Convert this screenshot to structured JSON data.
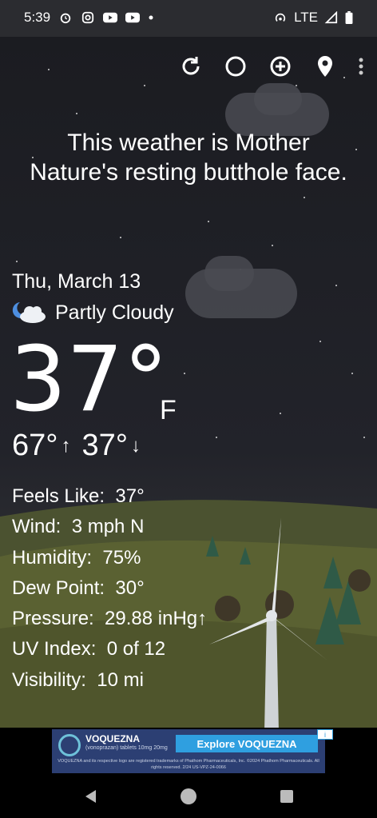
{
  "status_bar": {
    "time": "5:39",
    "left_icons": [
      "alarm-icon",
      "instagram-icon",
      "youtube-icon",
      "youtube-icon",
      "dot-icon"
    ],
    "network": "LTE",
    "right_icons": [
      "hotspot-icon",
      "signal-icon",
      "battery-icon"
    ]
  },
  "toolbar": {
    "icons": [
      "refresh-icon",
      "theme-icon",
      "add-location-icon",
      "location-pin-icon",
      "more-vert-icon"
    ]
  },
  "headline": "This weather is Mother Nature's resting butthole face.",
  "weather": {
    "date": "Thu, March 13",
    "condition": "Partly Cloudy",
    "condition_icon": "partly-cloudy-night-icon",
    "temperature": "37°",
    "unit": "F",
    "high": "67°",
    "low": "37°",
    "high_arrow": "↑",
    "low_arrow": "↓"
  },
  "details": [
    {
      "label": "Feels Like:",
      "value": "37°"
    },
    {
      "label": "Wind:",
      "value": "3 mph N"
    },
    {
      "label": "Humidity:",
      "value": "75%"
    },
    {
      "label": "Dew Point:",
      "value": "30°"
    },
    {
      "label": "Pressure:",
      "value": "29.88 inHg↑"
    },
    {
      "label": "UV Index:",
      "value": "0 of 12"
    },
    {
      "label": "Visibility:",
      "value": "10 mi"
    }
  ],
  "ad": {
    "brand": "VOQUEZNA",
    "brand_sub": "(vonoprazan) tablets 10mg 20mg",
    "cta": "Explore VOQUEZNA",
    "fine_print": "VOQUEZNA and its respective logo are registered trademarks of Phathom Pharmaceuticals, Inc. ©2024 Phathom Pharmaceuticals. All rights reserved. 2/24 US-VPZ-24-0066",
    "badge": "i"
  },
  "nav_bar": {
    "icons": [
      "back-icon",
      "home-icon",
      "recents-icon"
    ]
  },
  "colors": {
    "status_bar_bg": "#2b2c30",
    "sky": "#1e1f24",
    "hill_green": "#596032",
    "ad_bg": "#2c3f73",
    "ad_cta": "#2f9fe0"
  }
}
